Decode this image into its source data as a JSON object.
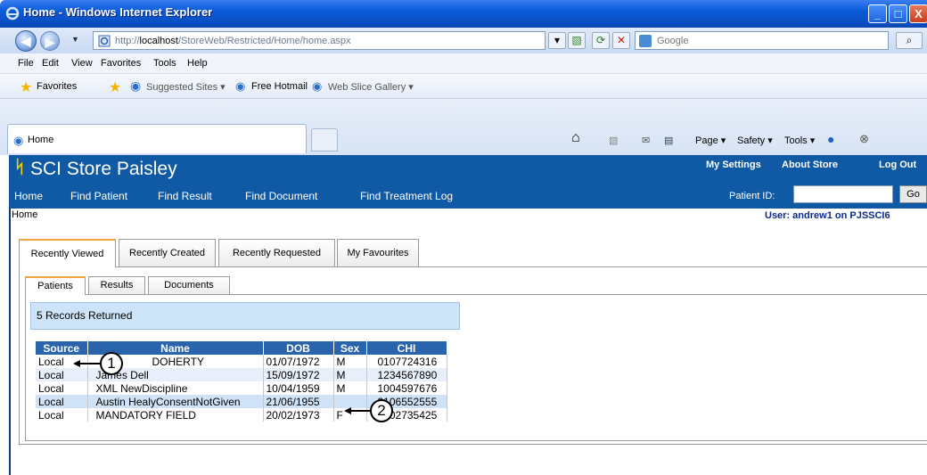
{
  "window": {
    "title": "Home - Windows Internet Explorer",
    "buttons": {
      "minimize": "_",
      "maximize": "□",
      "close": "X"
    }
  },
  "address_bar": {
    "url_prefix": "http://",
    "url_host": "localhost",
    "url_path": "/StoreWeb/Restricted/Home/home.aspx",
    "search_placeholder": "Google"
  },
  "menu": [
    "File",
    "Edit",
    "View",
    "Favorites",
    "Tools",
    "Help"
  ],
  "favorites_bar": {
    "favorites_label": "Favorites",
    "items": [
      "Suggested Sites ▾",
      "Free Hotmail",
      "Web Slice Gallery ▾"
    ]
  },
  "browser_tab": {
    "label": "Home"
  },
  "command_bar": {
    "page": "Page ▾",
    "safety": "Safety ▾",
    "tools": "Tools ▾"
  },
  "app": {
    "title": "SCI Store Paisley",
    "top_links": [
      "My Settings",
      "About Store",
      "Log Out"
    ],
    "nav": [
      "Home",
      "Find Patient",
      "Find Result",
      "Find Document",
      "Find Treatment Log"
    ],
    "patient_id_label": "Patient ID:",
    "patient_id_value": "",
    "go_label": "Go",
    "breadcrumb": "Home",
    "user_info": "User: andrew1 on PJSSCI6"
  },
  "outer_tabs": [
    "Recently Viewed",
    "Recently Created",
    "Recently Requested",
    "My Favourites"
  ],
  "inner_tabs": [
    "Patients",
    "Results",
    "Documents"
  ],
  "records_text": "5 Records Returned",
  "table": {
    "headers": [
      "Source",
      "Name",
      "DOB",
      "Sex",
      "CHI"
    ],
    "rows": [
      [
        "Local",
        "DOHERTY",
        "01/07/1972",
        "M",
        "0107724316"
      ],
      [
        "Local",
        "James Dell",
        "15/09/1972",
        "M",
        "1234567890"
      ],
      [
        "Local",
        "XML NewDiscipline",
        "10/04/1959",
        "M",
        "1004597676"
      ],
      [
        "Local",
        "Austin HealyConsentNotGiven",
        "21/06/1955",
        "",
        "2106552555"
      ],
      [
        "Local",
        "MANDATORY FIELD",
        "20/02/1973",
        "F",
        "2002735425"
      ]
    ]
  },
  "callouts": [
    "1",
    "2"
  ]
}
